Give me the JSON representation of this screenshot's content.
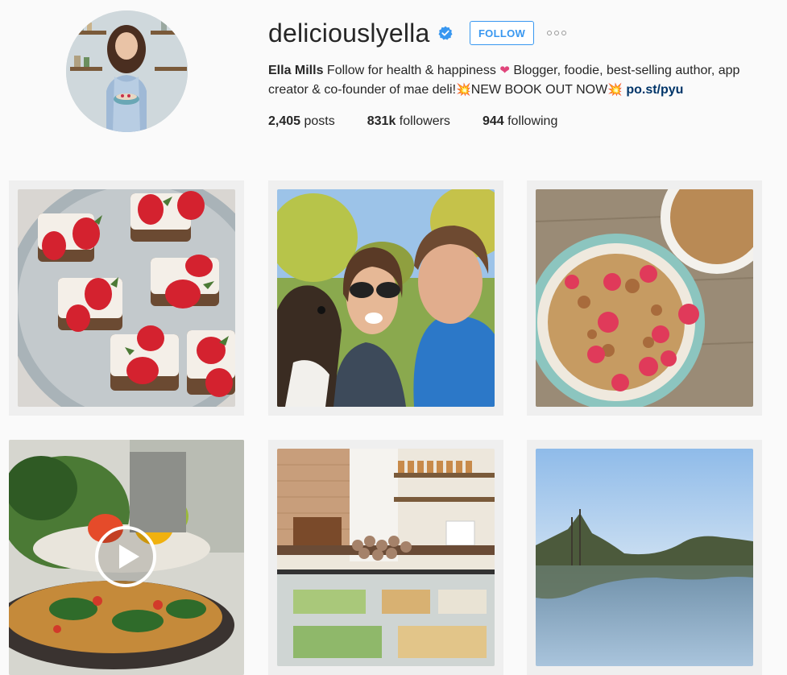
{
  "profile": {
    "username": "deliciouslyella",
    "verified": true,
    "follow_label": "FOLLOW",
    "more_label": "ooo",
    "full_name": "Ella Mills",
    "bio_part1": "Follow for health & happiness",
    "bio_heart": "❤",
    "bio_part2": "Blogger, foodie, best-selling author, app creator & co-founder of mae deli!",
    "bio_burst": "💥",
    "bio_part3": "NEW BOOK OUT NOW",
    "bio_link": "po.st/pyu"
  },
  "stats": {
    "posts_count": "2,405",
    "posts_label": "posts",
    "followers_count": "831k",
    "followers_label": "followers",
    "following_count": "944",
    "following_label": "following"
  },
  "colors": {
    "accent": "#3897f0",
    "link": "#003569",
    "heart": "#e0457b"
  },
  "posts": [
    {
      "subject": "strawberry-squares"
    },
    {
      "subject": "couple-selfie-with-dog"
    },
    {
      "subject": "granola-bowl"
    },
    {
      "subject": "salad-video",
      "is_video": true
    },
    {
      "subject": "deli-counter"
    },
    {
      "subject": "lake-landscape"
    }
  ]
}
